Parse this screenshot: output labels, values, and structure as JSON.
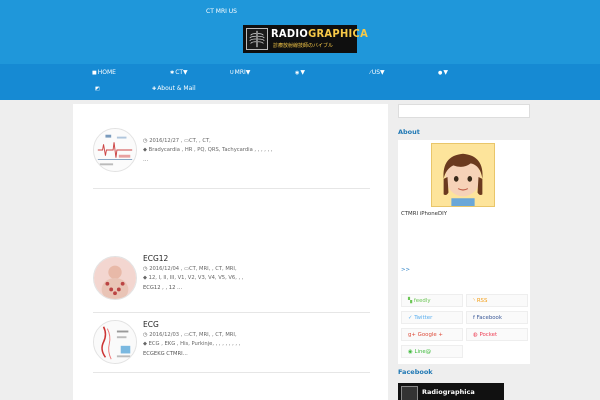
{
  "header": {
    "top_links": "CT MRI US",
    "logo_part1": "RADIO",
    "logo_part2": "GRAPHICA",
    "logo_sub": "診療放射線技師のバイブル"
  },
  "nav": [
    {
      "icon": "home-icon",
      "glyph": "■",
      "label": "HOME"
    },
    {
      "icon": "gear-icon",
      "glyph": "✱",
      "label": "CT▼"
    },
    {
      "icon": "magnet-icon",
      "glyph": "Ս",
      "label": "MRI▼"
    },
    {
      "icon": "eye-icon",
      "glyph": "◉",
      "label": "▼"
    },
    {
      "icon": "wand-icon",
      "glyph": "⁄",
      "label": "US▼"
    },
    {
      "icon": "user-icon",
      "glyph": "●",
      "label": "▼"
    },
    {
      "icon": "chart-icon",
      "glyph": "◩",
      "label": ""
    },
    {
      "icon": "cross-icon",
      "glyph": "✚",
      "label": "About & Mail"
    }
  ],
  "posts": [
    {
      "title": "",
      "date": "2016/12/27",
      "categories": "CT, , CT, ",
      "tags": "Bradycardia , HR , PQ, QRS, Tachycardia , , , , , , ",
      "excerpt": "  …"
    },
    {
      "title": "ECG12",
      "date": "2016/12/04",
      "categories": "CT, MRI, , CT, MRI, ",
      "tags": "12, I, II, III, V1, V2, V3, V4, V5, V6, , , ",
      "excerpt": "ECG12 , , 12 …"
    },
    {
      "title": "ECG",
      "date": "2016/12/03",
      "categories": "CT, MRI, , CT, MRI, ",
      "tags": "ECG , EKG , His, Purkinje, , , , , , , , , ",
      "excerpt": "ECGEKG CTMRI…"
    }
  ],
  "ads": {
    "label": ""
  },
  "sidebar": {
    "search_placeholder": "",
    "about_title": "About",
    "about_text": "CTMRI iPhoneDIY",
    "about_name": "",
    "about_more": ">>",
    "follow_title": "",
    "follow": [
      {
        "icon": "feedly-icon",
        "label": "feedly",
        "color": "#6cc655"
      },
      {
        "icon": "rss-icon",
        "label": "RSS",
        "color": "#f39c12"
      },
      {
        "icon": "twitter-icon",
        "label": "Twitter",
        "color": "#55acee"
      },
      {
        "icon": "facebook-icon",
        "label": "Facebook",
        "color": "#3b5998"
      },
      {
        "icon": "google-plus-icon",
        "label": "Google +",
        "color": "#dd4b39"
      },
      {
        "icon": "pocket-icon",
        "label": "Pocket",
        "color": "#ee4056"
      },
      {
        "icon": "line-icon",
        "label": "Line@",
        "color": "#3dba3a"
      }
    ],
    "facebook_title": "Facebook",
    "facebook_page": "Radiographica"
  }
}
